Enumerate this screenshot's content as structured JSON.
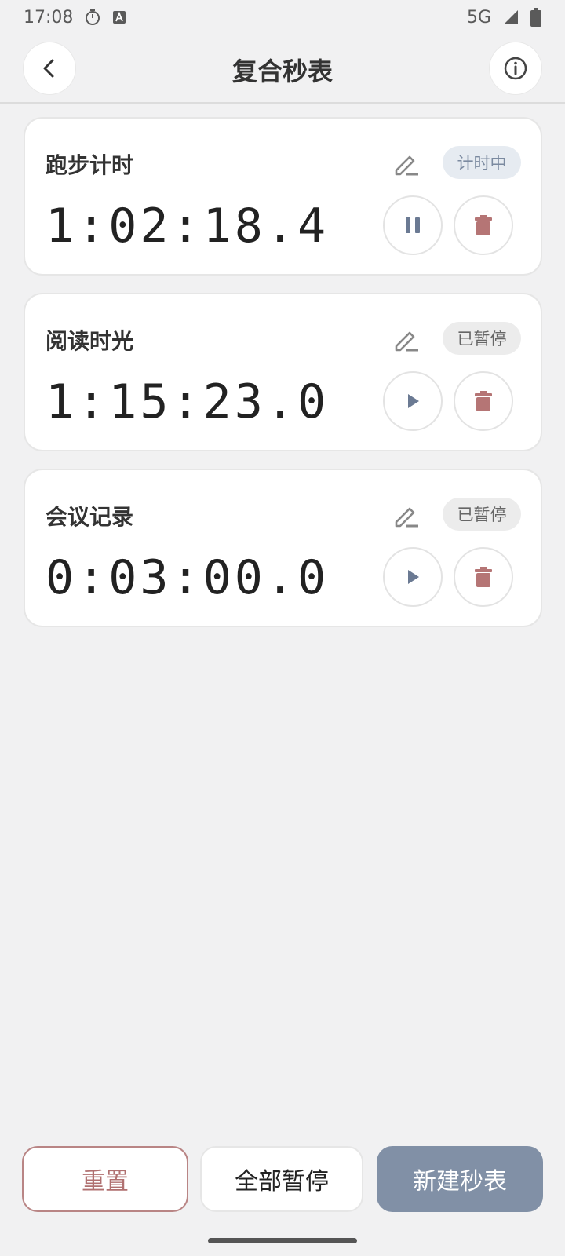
{
  "status_bar": {
    "time": "17:08",
    "network": "5G",
    "icons": [
      "stopwatch-icon",
      "keyboard-a-icon",
      "signal-icon",
      "battery-icon"
    ]
  },
  "header": {
    "title": "复合秒表",
    "back_icon": "chevron-left-icon",
    "info_icon": "info-icon"
  },
  "timers": [
    {
      "name": "跑步计时",
      "time": "1:02:18.4",
      "status": "计时中",
      "state": "running"
    },
    {
      "name": "阅读时光",
      "time": "1:15:23.0",
      "status": "已暂停",
      "state": "paused"
    },
    {
      "name": "会议记录",
      "time": "0:03:00.0",
      "status": "已暂停",
      "state": "paused"
    }
  ],
  "actions": {
    "reset_label": "重置",
    "pause_all_label": "全部暂停",
    "new_label": "新建秒表"
  },
  "colors": {
    "background": "#f1f1f2",
    "accent": "#8190a6",
    "danger": "#b07070",
    "play_icon": "#6b7a93",
    "delete_icon": "#b57575"
  }
}
